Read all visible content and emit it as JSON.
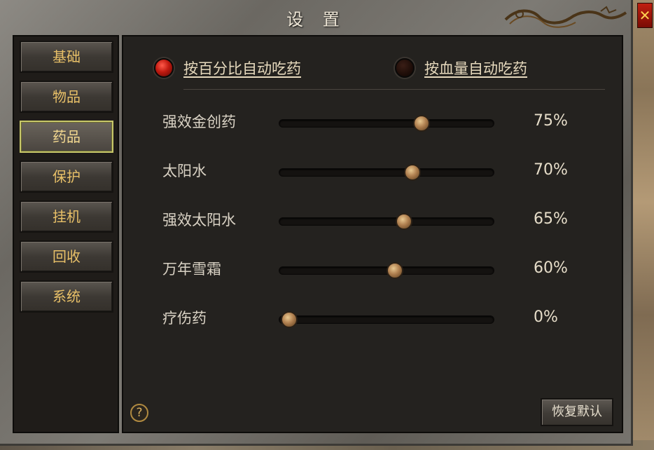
{
  "window": {
    "title": "设 置",
    "close_label": "✕"
  },
  "sidebar": {
    "items": [
      {
        "label": "基础",
        "active": false
      },
      {
        "label": "物品",
        "active": false
      },
      {
        "label": "药品",
        "active": true
      },
      {
        "label": "保护",
        "active": false
      },
      {
        "label": "挂机",
        "active": false
      },
      {
        "label": "回收",
        "active": false
      },
      {
        "label": "系统",
        "active": false
      }
    ]
  },
  "modes": {
    "percent": {
      "label": "按百分比自动吃药",
      "selected": true
    },
    "hp": {
      "label": "按血量自动吃药",
      "selected": false
    }
  },
  "potions": [
    {
      "name": "强效金创药",
      "percent": 75,
      "percent_text": "75%"
    },
    {
      "name": "太阳水",
      "percent": 70,
      "percent_text": "70%"
    },
    {
      "name": "强效太阳水",
      "percent": 65,
      "percent_text": "65%"
    },
    {
      "name": "万年雪霜",
      "percent": 60,
      "percent_text": "60%"
    },
    {
      "name": "疗伤药",
      "percent": 0,
      "percent_text": "0%"
    }
  ],
  "footer": {
    "help_label": "?",
    "reset_label": "恢复默认"
  },
  "colors": {
    "accent_gold": "#e8c068",
    "active_border": "#c8c86a",
    "radio_on": "#c01a10"
  },
  "icons": {
    "close": "close-icon",
    "help": "help-icon",
    "dragon": "dragon-ornament-icon"
  }
}
